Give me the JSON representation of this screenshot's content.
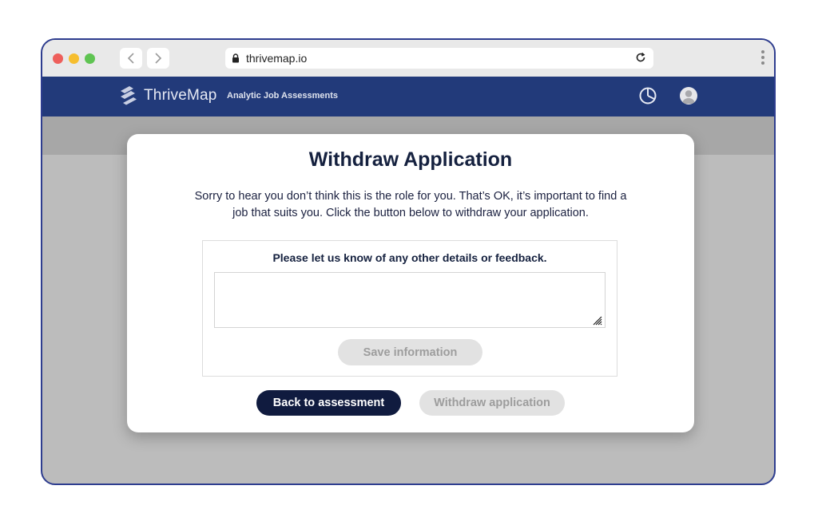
{
  "browser": {
    "url": "thrivemap.io",
    "icons": {
      "back": "chevron-left-icon",
      "forward": "chevron-right-icon",
      "lock": "lock-icon",
      "reload": "reload-icon",
      "menu": "kebab-menu-icon"
    }
  },
  "header": {
    "brand": "ThriveMap",
    "tagline": "Analytic Job Assessments",
    "icons": {
      "timer": "timer-icon",
      "profile": "avatar-icon"
    }
  },
  "modal": {
    "title": "Withdraw Application",
    "description": "Sorry to hear you don’t think this is the role for you. That’s OK, it’s important to find a job that suits you. Click the button below to withdraw your application.",
    "feedback": {
      "label": "Please let us know of any other details or feedback.",
      "value": "",
      "placeholder": "",
      "save_label": "Save information"
    },
    "back_label": "Back to assessment",
    "withdraw_label": "Withdraw application"
  },
  "colors": {
    "header_bg": "#223a7a",
    "primary_button": "#101b3f",
    "disabled_button": "#e2e2e2",
    "disabled_text": "#9d9d9d",
    "window_border": "#2e3d8f",
    "overlay_bg": "#bcbcbc"
  }
}
